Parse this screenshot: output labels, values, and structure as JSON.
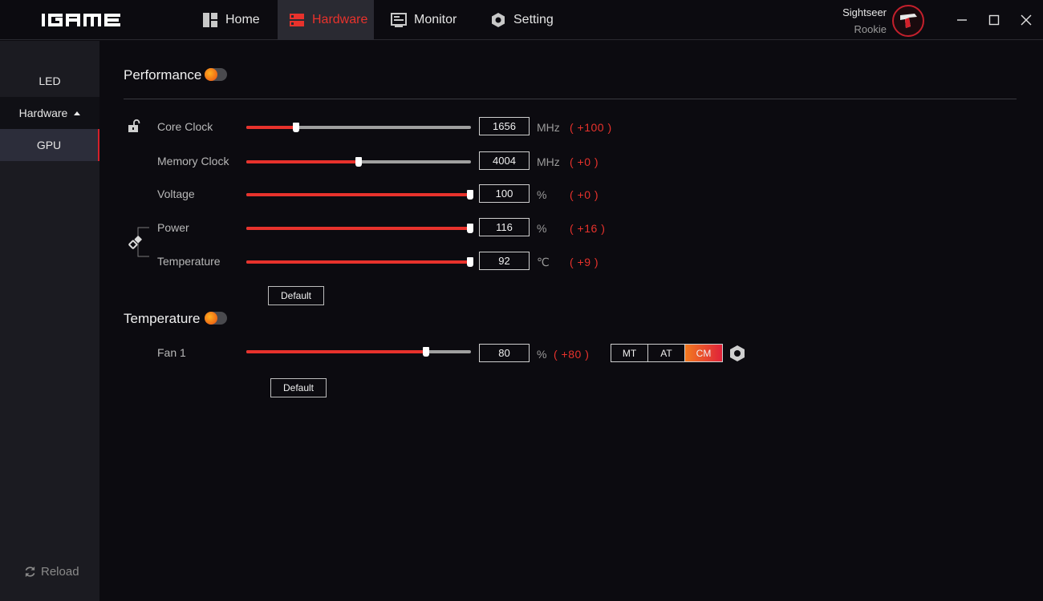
{
  "app": {
    "logo_text": "iGAME"
  },
  "nav": {
    "tabs": [
      {
        "label": "Home",
        "icon": "grid-icon"
      },
      {
        "label": "Hardware",
        "icon": "hardware-icon",
        "active": true
      },
      {
        "label": "Monitor",
        "icon": "monitor-icon"
      },
      {
        "label": "Setting",
        "icon": "hex-gear-icon"
      }
    ]
  },
  "user": {
    "name": "Sightseer",
    "rank": "Rookie"
  },
  "sidebar": {
    "items": [
      {
        "label": "LED"
      },
      {
        "label": "Hardware"
      },
      {
        "label": "GPU"
      }
    ],
    "reload_label": "Reload"
  },
  "performance": {
    "title": "Performance",
    "default_label": "Default",
    "rows": [
      {
        "label": "Core Clock",
        "value": "1656",
        "unit": "MHz",
        "delta": "( +100 )",
        "fraction": 0.22
      },
      {
        "label": "Memory Clock",
        "value": "4004",
        "unit": "MHz",
        "delta": "( +0 )",
        "fraction": 0.5
      },
      {
        "label": "Voltage",
        "value": "100",
        "unit": "%",
        "delta": "( +0 )",
        "fraction": 1.0
      },
      {
        "label": "Power",
        "value": "116",
        "unit": "%",
        "delta": "( +16 )",
        "fraction": 1.0
      },
      {
        "label": "Temperature",
        "value": "92",
        "unit": "℃",
        "delta": "( +9 )",
        "fraction": 1.0
      }
    ]
  },
  "temperature": {
    "title": "Temperature",
    "default_label": "Default",
    "fan": {
      "label": "Fan 1",
      "value": "80",
      "unit": "%",
      "delta": "( +80 )",
      "fraction": 0.8
    },
    "modes": [
      "MT",
      "AT",
      "CM"
    ],
    "active_mode": "CM"
  },
  "colors": {
    "accent": "#e8322c",
    "active_tab_bg": "#2a2a32",
    "sidebar_bg": "#1b1b21"
  }
}
